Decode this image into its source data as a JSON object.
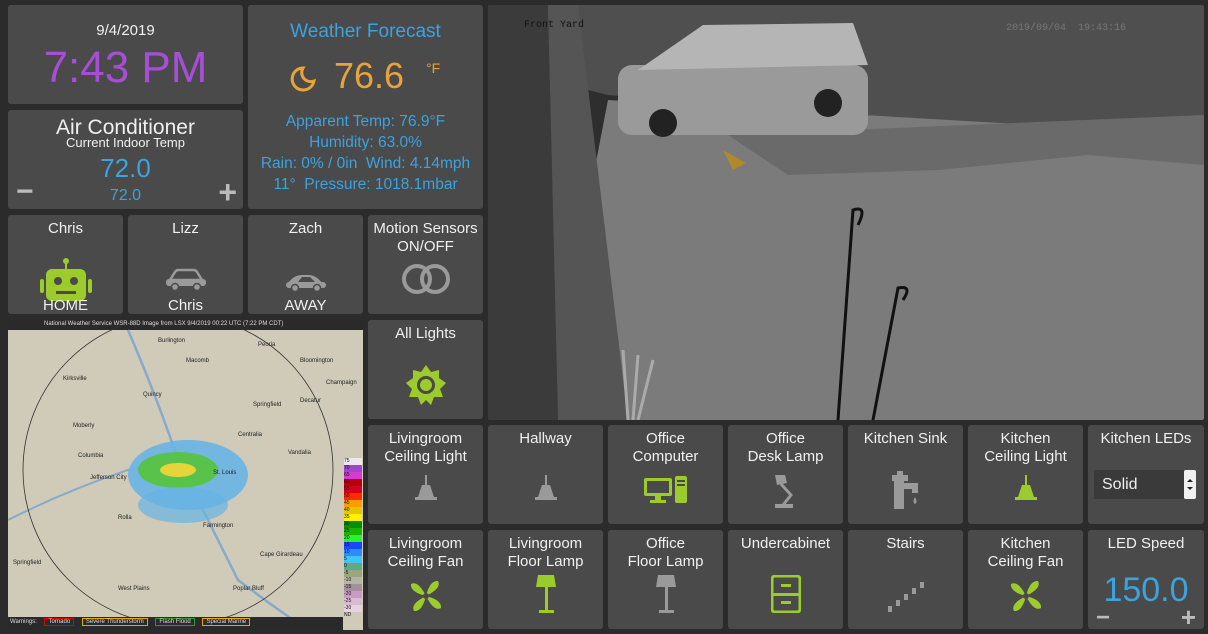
{
  "clock": {
    "date": "9/4/2019",
    "time": "7:43 PM"
  },
  "ac": {
    "title": "Air Conditioner",
    "subtitle": "Current Indoor Temp",
    "temp": "72.0",
    "setpoint": "72.0",
    "minus": "−",
    "plus": "+"
  },
  "weather": {
    "title": "Weather Forecast",
    "temp": "76.6",
    "unit": "°F",
    "apparent": "Apparent Temp: 76.9°F",
    "humidity": "Humidity: 63.0%",
    "rain_wind": "Rain: 0% / 0in  Wind: 4.14mph",
    "pressure": "11°  Pressure: 1018.1mbar"
  },
  "presence": [
    {
      "name": "Chris",
      "status": "HOME"
    },
    {
      "name": "Lizz",
      "status": "Chris"
    },
    {
      "name": "Zach",
      "status": "AWAY"
    }
  ],
  "motion": {
    "title_line1": "Motion Sensors",
    "title_line2": "ON/OFF"
  },
  "all_lights": {
    "title": "All Lights"
  },
  "camera": {
    "label": "Front Yard",
    "timestamp": "2019/09/04  19:43:16"
  },
  "radar": {
    "header": "National Weather Service WSR-88D Image from LSX 9/4/2019 00:22 UTC (7:22 PM CDT)",
    "cities": [
      "Burlington",
      "Macomb",
      "Peoria",
      "Bloomington",
      "Champaign",
      "Quincy",
      "Springfield",
      "Decatur",
      "Kirksville",
      "Moberly",
      "Columbia",
      "Jefferson City",
      "St. Louis",
      "Centralia",
      "Vandalia",
      "Rolla",
      "Farmington",
      "Cape Girardeau",
      "Poplar Bluff",
      "West Plains",
      "Springfield"
    ],
    "legend_values": [
      "75",
      "70",
      "65",
      "60",
      "55",
      "50",
      "45",
      "40",
      "35",
      "30",
      "25",
      "20",
      "15",
      "10",
      "5",
      "0",
      "-5",
      "-10",
      "-15",
      "-20",
      "-25",
      "-30",
      "ND"
    ],
    "warnings": [
      "Warnings:",
      "Tornado",
      "Severe Thunderstorm",
      "Flash Flood",
      "Special Marine"
    ]
  },
  "row1": [
    {
      "line1": "Livingroom",
      "line2": "Ceiling Light",
      "icon": "ceiling-light-icon"
    },
    {
      "line1": "Hallway",
      "line2": "",
      "icon": "ceiling-light-icon"
    },
    {
      "line1": "Office",
      "line2": "Computer",
      "icon": "computer-icon"
    },
    {
      "line1": "Office",
      "line2": "Desk Lamp",
      "icon": "desk-lamp-icon"
    },
    {
      "line1": "Kitchen Sink",
      "line2": "",
      "icon": "faucet-icon"
    },
    {
      "line1": "Kitchen",
      "line2": "Ceiling Light",
      "icon": "ceiling-light-icon"
    }
  ],
  "row2": [
    {
      "line1": "Livingroom",
      "line2": "Ceiling Fan",
      "icon": "fan-icon"
    },
    {
      "line1": "Livingroom",
      "line2": "Floor Lamp",
      "icon": "floor-lamp-icon"
    },
    {
      "line1": "Office",
      "line2": "Floor Lamp",
      "icon": "floor-lamp-icon"
    },
    {
      "line1": "Undercabinet",
      "line2": "",
      "icon": "cabinet-icon"
    },
    {
      "line1": "Stairs",
      "line2": "",
      "icon": "stairs-icon"
    },
    {
      "line1": "Kitchen",
      "line2": "Ceiling Fan",
      "icon": "fan-icon"
    }
  ],
  "leds": {
    "title": "Kitchen LEDs",
    "selected": "Solid"
  },
  "led_speed": {
    "title": "LED Speed",
    "value": "150.0",
    "minus": "−",
    "plus": "+"
  },
  "colors": {
    "green": "#9ccc2c",
    "blue": "#3aa3e0",
    "orange": "#e8a33a",
    "purple": "#a64fd6",
    "tile": "#4a4a4a"
  }
}
